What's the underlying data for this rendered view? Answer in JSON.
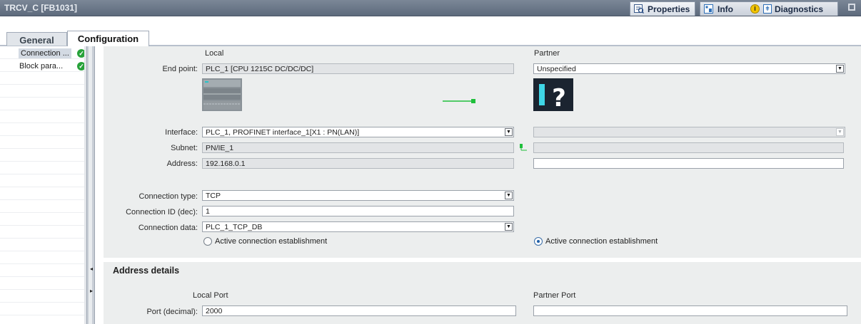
{
  "titlebar": {
    "title": "TRCV_C [FB1031]",
    "tabs": [
      {
        "label": "Properties",
        "icon": "properties-icon"
      },
      {
        "label": "Info",
        "icon": "info-icon"
      },
      {
        "label": "Diagnostics",
        "icon": "diagnostics-icon"
      }
    ]
  },
  "subtabs": [
    "General",
    "Configuration"
  ],
  "nav": {
    "items": [
      {
        "label": "Connection ...",
        "status": "ok"
      },
      {
        "label": "Block para...",
        "status": "ok"
      }
    ]
  },
  "config": {
    "local_header": "Local",
    "partner_header": "Partner",
    "end_point_label": "End point:",
    "end_point_local": "PLC_1 [CPU 1215C DC/DC/DC]",
    "end_point_partner": "Unspecified",
    "interface_label": "Interface:",
    "interface_local": "PLC_1, PROFINET interface_1[X1 : PN(LAN)]",
    "interface_partner": "",
    "subnet_label": "Subnet:",
    "subnet_local": "PN/IE_1",
    "subnet_partner": "",
    "address_label": "Address:",
    "address_local": "192.168.0.1",
    "address_partner": "",
    "connection_type_label": "Connection type:",
    "connection_type": "TCP",
    "connection_id_label": "Connection ID (dec):",
    "connection_id": "1",
    "connection_data_label": "Connection data:",
    "connection_data": "PLC_1_TCP_DB",
    "local_active_label": "Active connection establishment",
    "partner_active_label": "Active connection establishment",
    "local_active_selected": false,
    "partner_active_selected": true,
    "partner_device_glyph": "?"
  },
  "address_details": {
    "title": "Address details",
    "local_port_header": "Local Port",
    "partner_port_header": "Partner Port",
    "port_label": "Port (decimal):",
    "local_port": "2000",
    "partner_port": ""
  },
  "colors": {
    "titlebar": "#6b7788",
    "ok": "#27a23a",
    "link": "#1fbf3b",
    "partner_accent": "#3fd6e6"
  }
}
